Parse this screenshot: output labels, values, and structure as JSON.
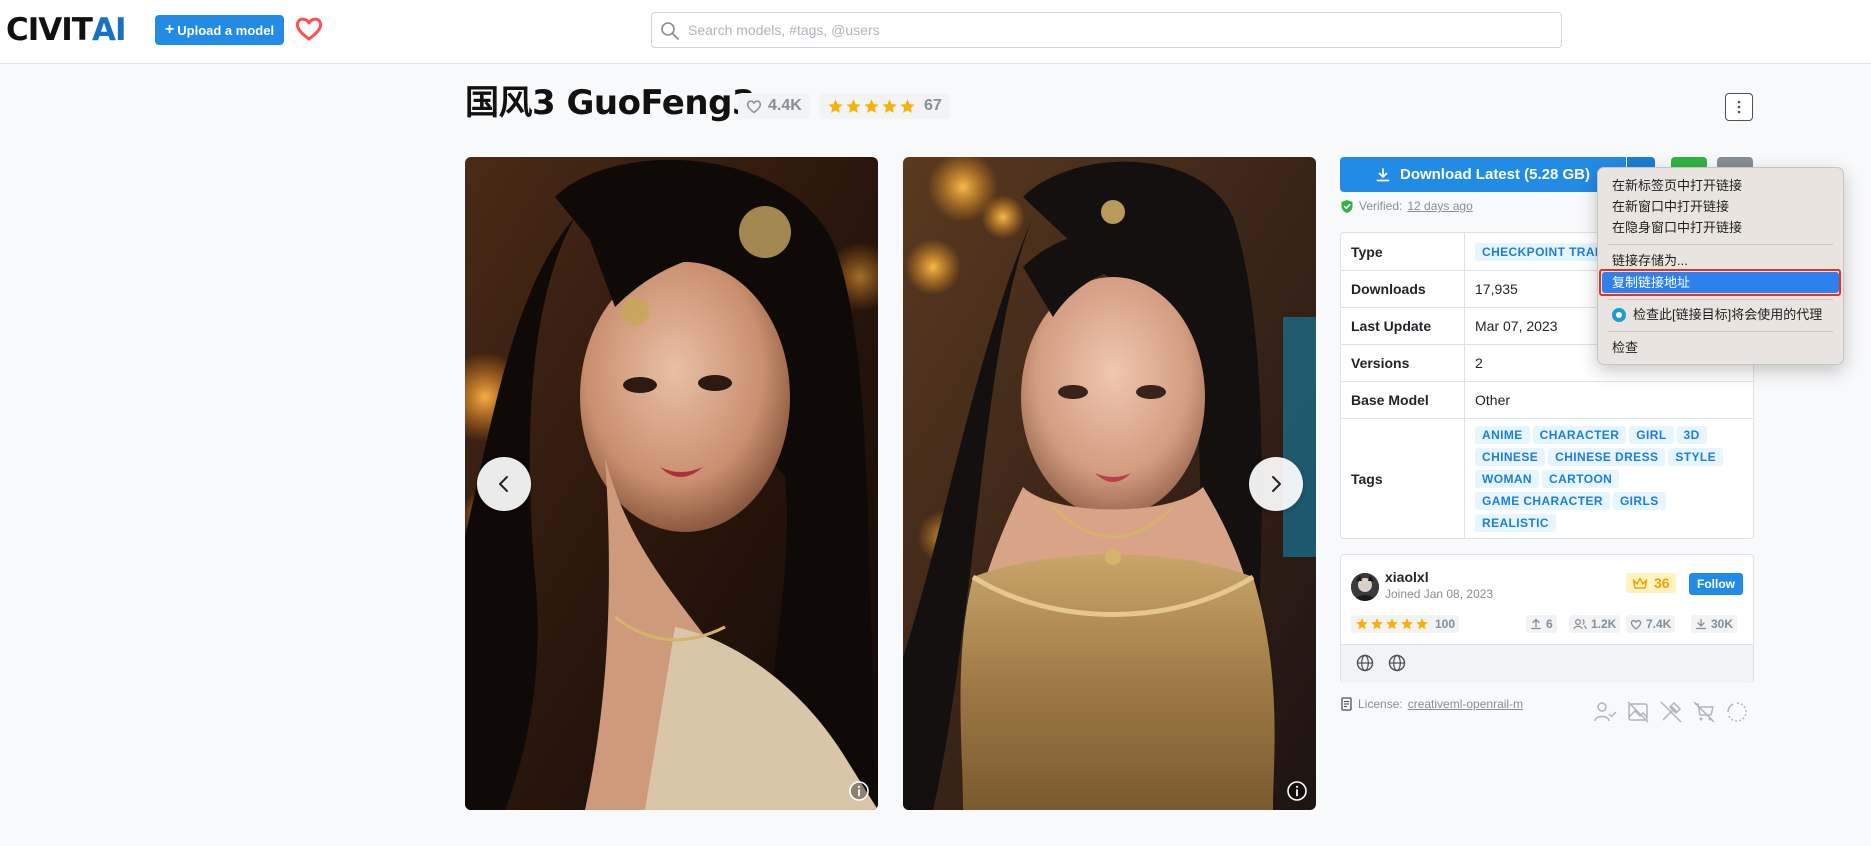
{
  "header": {
    "logo_civ": "CIVIT",
    "logo_ai": "AI",
    "upload_label": "Upload a model",
    "search_placeholder": "Search models, #tags, @users"
  },
  "model": {
    "title": "国风3 GuoFeng3",
    "favorites": "4.4K",
    "rating_count": "67",
    "rating_stars": 5
  },
  "download": {
    "label": "Download Latest (5.28 GB)",
    "verified_prefix": "Verified:",
    "verified_when": "12 days ago"
  },
  "details": [
    {
      "key": "Type",
      "value": "CHECKPOINT TRAINED",
      "is_tag": true
    },
    {
      "key": "Downloads",
      "value": "17,935"
    },
    {
      "key": "Last Update",
      "value": "Mar 07, 2023"
    },
    {
      "key": "Versions",
      "value": "2"
    },
    {
      "key": "Base Model",
      "value": "Other"
    }
  ],
  "tags_label": "Tags",
  "tags": [
    "ANIME",
    "CHARACTER",
    "GIRL",
    "3D",
    "CHINESE",
    "CHINESE DRESS",
    "STYLE",
    "WOMAN",
    "CARTOON",
    "GAME CHARACTER",
    "GIRLS",
    "REALISTIC"
  ],
  "creator": {
    "username": "xiaolxl",
    "joined": "Joined Jan 08, 2023",
    "rank": "36",
    "follow_label": "Follow",
    "rating": "100",
    "uploads": "6",
    "followers": "1.2K",
    "favorites": "7.4K",
    "downloads": "30K"
  },
  "license": {
    "prefix": "License:",
    "name": "creativeml-openrail-m"
  },
  "context_menu": {
    "items": [
      "在新标签页中打开链接",
      "在新窗口中打开链接",
      "在隐身窗口中打开链接",
      "链接存储为...",
      "复制链接地址",
      "检查此[链接目标]将会使用的代理",
      "检查"
    ],
    "highlighted_index": 4
  },
  "colors": {
    "accent": "#228be6",
    "star": "#fab005",
    "verified": "#2fb344",
    "menu_highlight": "#2f80ed",
    "highlight_outline": "#e03131"
  }
}
